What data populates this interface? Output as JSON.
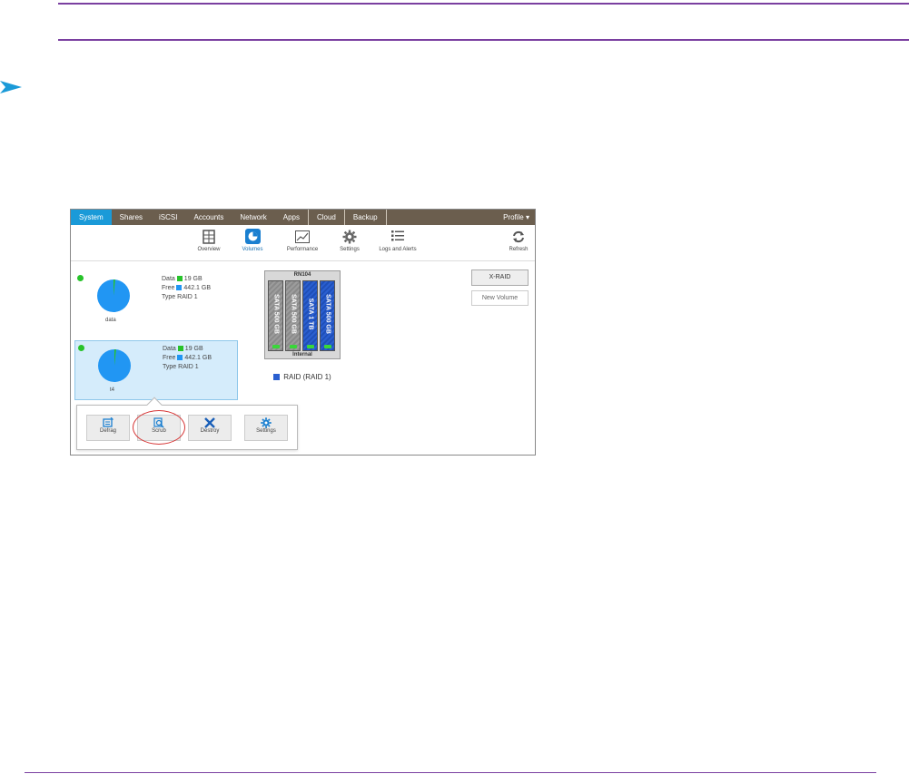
{
  "top_nav": {
    "tabs": [
      "System",
      "Shares",
      "iSCSI",
      "Accounts",
      "Network",
      "Apps",
      "Cloud",
      "Backup"
    ],
    "profile": "Profile ▾"
  },
  "sub_nav": {
    "items": [
      "Overview",
      "Volumes",
      "Performance",
      "Settings",
      "Logs and Alerts"
    ],
    "refresh": "Refresh"
  },
  "volumes": [
    {
      "name": "data",
      "data_label": "Data",
      "data_value": "19 GB",
      "free_label": "Free",
      "free_value": "442.1 GB",
      "type_label": "Type",
      "type_value": "RAID 1"
    },
    {
      "name": "t4",
      "data_label": "Data",
      "data_value": "19 GB",
      "free_label": "Free",
      "free_value": "442.1 GB",
      "type_label": "Type",
      "type_value": "RAID 1"
    }
  ],
  "enclosure": {
    "model": "RN104",
    "disks": [
      "SATA 500 GB",
      "SATA 500 GB",
      "SATA 1 TB",
      "SATA 500 GB"
    ],
    "label": "Internal"
  },
  "raid_label": "RAID (RAID 1)",
  "xraid_button": "X-RAID",
  "new_volume_button": "New Volume",
  "popup": {
    "buttons": [
      "Defrag",
      "Scrub",
      "Destroy",
      "Settings"
    ]
  },
  "colors": {
    "accent_purple": "#7a3fa0",
    "nav_bg": "#6b5e4e",
    "active_tab": "#1a9ad8",
    "data_green": "#27c32a",
    "free_blue": "#2196f3",
    "highlight_red": "#d63535"
  }
}
